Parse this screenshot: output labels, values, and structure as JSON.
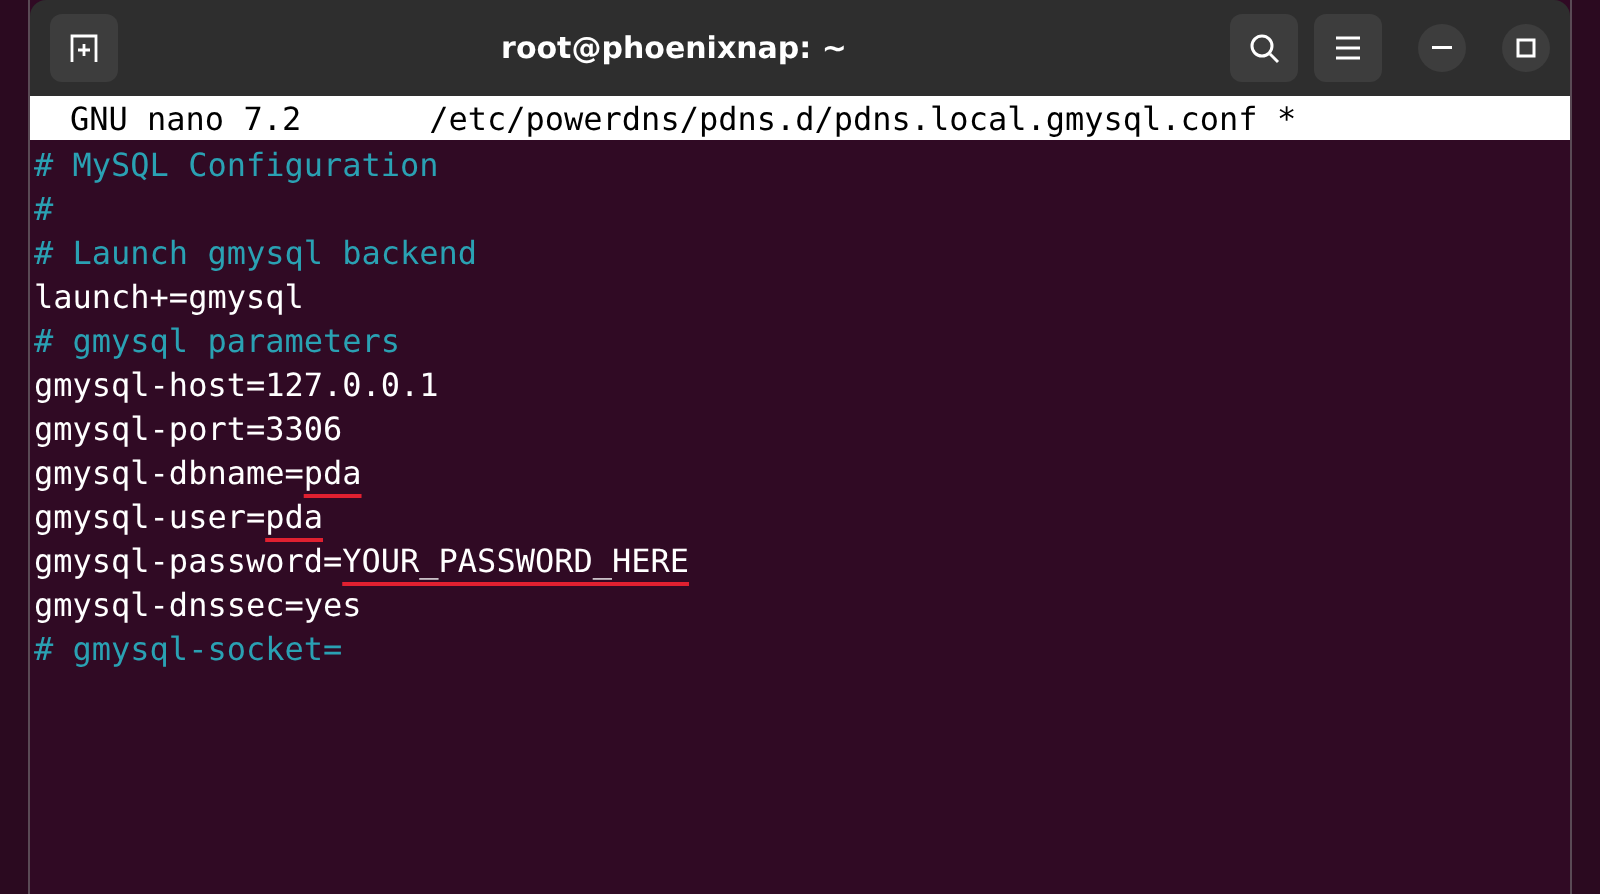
{
  "window": {
    "title": "root@phoenixnap: ~"
  },
  "nano_header": {
    "version": "GNU nano 7.2",
    "file": "/etc/powerdns/pdns.d/pdns.local.gmysql.conf *"
  },
  "lines": [
    {
      "kind": "comment",
      "text": "# MySQL Configuration"
    },
    {
      "kind": "comment",
      "text": "#"
    },
    {
      "kind": "comment",
      "text": "# Launch gmysql backend"
    },
    {
      "kind": "setting",
      "text": "launch+=gmysql"
    },
    {
      "kind": "comment",
      "text": "# gmysql parameters"
    },
    {
      "kind": "setting",
      "text": "gmysql-host=127.0.0.1"
    },
    {
      "kind": "setting",
      "text": "gmysql-port=3306"
    },
    {
      "kind": "marked",
      "text": "gmysql-dbname=",
      "value": "pda"
    },
    {
      "kind": "marked",
      "text": "gmysql-user=",
      "value": "pda"
    },
    {
      "kind": "marked",
      "text": "gmysql-password=",
      "value": "YOUR_PASSWORD_HERE"
    },
    {
      "kind": "setting",
      "text": "gmysql-dnssec=yes"
    },
    {
      "kind": "comment",
      "text": "# gmysql-socket="
    }
  ]
}
